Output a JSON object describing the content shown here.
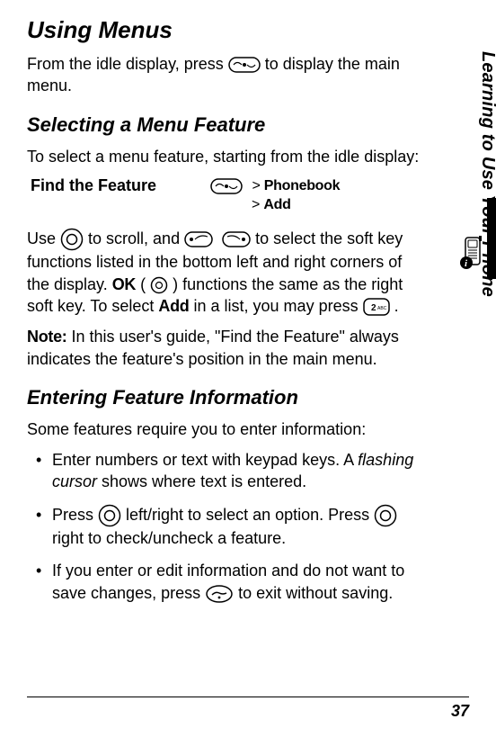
{
  "headings": {
    "h1": "Using Menus",
    "h2a": "Selecting a Menu Feature",
    "h2b": "Entering Feature Information"
  },
  "para": {
    "intro_a": "From the idle display, press ",
    "intro_b": " to display the main menu.",
    "select_intro": "To select a menu feature, starting from the idle display:",
    "use_a": "Use ",
    "use_b": " to scroll, and ",
    "use_c": " to select the soft key functions listed in the bottom left and right corners of the display. ",
    "use_d": " ( ",
    "use_e": " ) functions the same as the right soft key. To select ",
    "use_f": " in a list, you may press ",
    "use_g": " .",
    "note_label": "Note:",
    "note_body": " In this user's guide, \"Find the Feature\" always indicates the feature's position in the main menu.",
    "enter_intro": "Some features require you to enter information:"
  },
  "find": {
    "label": "Find the Feature",
    "path1": "Phonebook",
    "path2": "Add"
  },
  "ui_terms": {
    "ok": "OK",
    "add": "Add"
  },
  "bullets": {
    "b1a": "Enter numbers or text with keypad keys. A ",
    "b1term": "flashing cursor",
    "b1b": " shows where text is entered.",
    "b2a": "Press ",
    "b2b": " left/right to select an option. Press ",
    "b2c": " right to check/uncheck a feature.",
    "b3a": "If you enter or edit information and do not want to save changes, press ",
    "b3b": " to exit without saving."
  },
  "side": {
    "label": "Learning to Use Your Phone"
  },
  "page_number": "37"
}
